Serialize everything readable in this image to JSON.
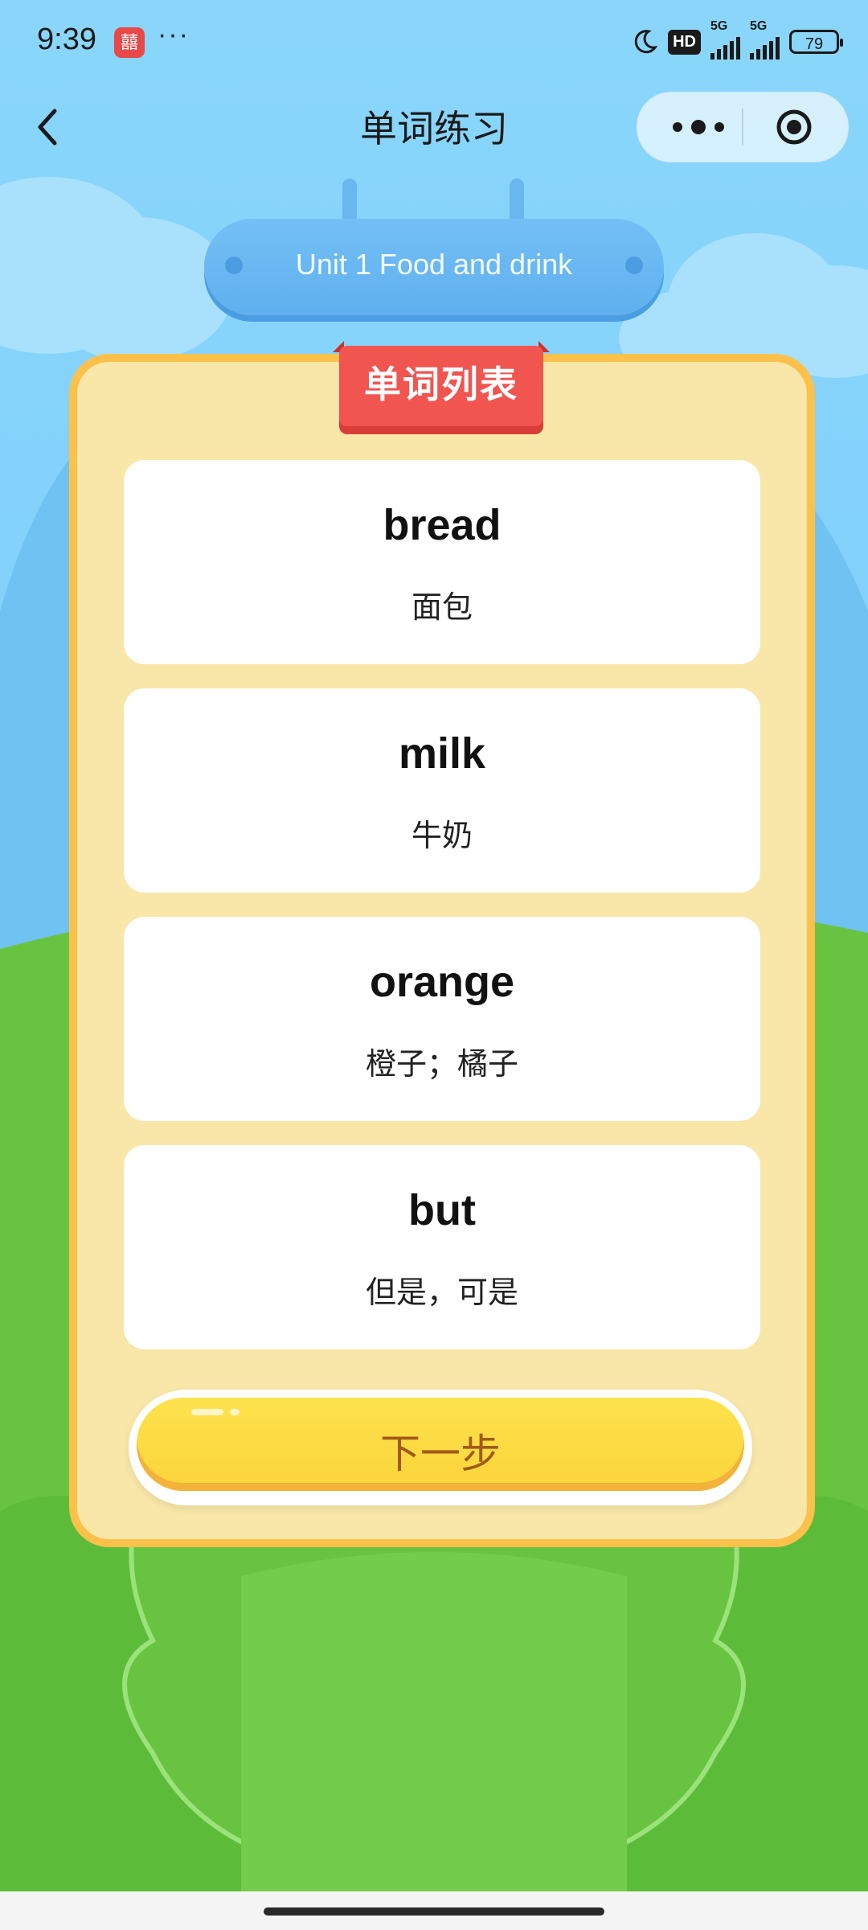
{
  "status_bar": {
    "time": "9:39",
    "app_icon_glyph": "囍",
    "more_dots": "···",
    "hd_badge": "HD",
    "signal_1_label": "5G",
    "signal_2_label": "5G",
    "battery": "79"
  },
  "nav": {
    "title": "单词练习",
    "back_icon": "chevron-left-icon",
    "more_icon": "more-dots-icon",
    "close_icon": "target-icon"
  },
  "unit": {
    "title": "Unit 1 Food and drink"
  },
  "list": {
    "ribbon_title": "单词列表",
    "words": [
      {
        "word": "bread",
        "meaning": "面包"
      },
      {
        "word": "milk",
        "meaning": "牛奶"
      },
      {
        "word": "orange",
        "meaning": "橙子；橘子"
      },
      {
        "word": "but",
        "meaning": "但是，可是"
      }
    ]
  },
  "actions": {
    "next_label": "下一步"
  },
  "colors": {
    "sky": "#80d0fb",
    "grass": "#6cc64a",
    "card_bg": "#f8e7a8",
    "card_border": "#fcc14a",
    "ribbon": "#f05550",
    "button": "#fbd43a",
    "button_text": "#a05a1a"
  }
}
